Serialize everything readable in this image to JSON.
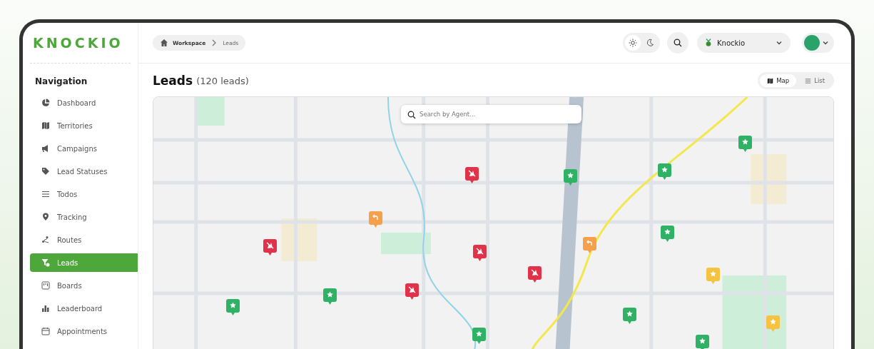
{
  "logo": {
    "text": "KNOCKIO"
  },
  "sidebar": {
    "heading": "Navigation",
    "items": [
      {
        "label": "Dashboard",
        "selected": false
      },
      {
        "label": "Territories",
        "selected": false
      },
      {
        "label": "Campaigns",
        "selected": false
      },
      {
        "label": "Lead Statuses",
        "selected": false
      },
      {
        "label": "Todos",
        "selected": false
      },
      {
        "label": "Tracking",
        "selected": false
      },
      {
        "label": "Routes",
        "selected": false
      },
      {
        "label": "Leads",
        "selected": true
      },
      {
        "label": "Boards",
        "selected": false
      },
      {
        "label": "Leaderboard",
        "selected": false
      },
      {
        "label": "Appointments",
        "selected": false
      }
    ]
  },
  "breadcrumb": [
    {
      "label": "Workspace"
    },
    {
      "label": "Leads"
    }
  ],
  "header": {
    "theme_modes": [
      {
        "selected": true
      },
      {
        "selected": false
      }
    ],
    "organization": "Knockio"
  },
  "page": {
    "title": "Leads",
    "count": "(120 leads)"
  },
  "view_toggle": [
    {
      "label": "Map",
      "selected": true
    },
    {
      "label": "List",
      "selected": false
    }
  ],
  "map": {
    "search": {
      "placeholder": "Search by Agent..."
    },
    "pins": [
      {
        "kind": "blocked",
        "color": "#e0334a"
      },
      {
        "kind": "star",
        "color": "#2fb266"
      },
      {
        "kind": "star",
        "color": "#2fb266"
      },
      {
        "kind": "star",
        "color": "#2fb266"
      },
      {
        "kind": "return",
        "color": "#f5a04a"
      },
      {
        "kind": "blocked",
        "color": "#e0334a"
      },
      {
        "kind": "blocked",
        "color": "#e0334a"
      },
      {
        "kind": "return",
        "color": "#f5a04a"
      },
      {
        "kind": "star",
        "color": "#2fb266"
      },
      {
        "kind": "blocked",
        "color": "#e0334a"
      },
      {
        "kind": "blocked",
        "color": "#e0334a"
      },
      {
        "kind": "star",
        "color": "#2fb266"
      },
      {
        "kind": "star",
        "color": "#2fb266"
      },
      {
        "kind": "star",
        "color": "#f5c242"
      },
      {
        "kind": "star",
        "color": "#2fb266"
      },
      {
        "kind": "star",
        "color": "#f5c242"
      },
      {
        "kind": "star",
        "color": "#2fb266"
      },
      {
        "kind": "star",
        "color": "#2fb266"
      }
    ]
  }
}
